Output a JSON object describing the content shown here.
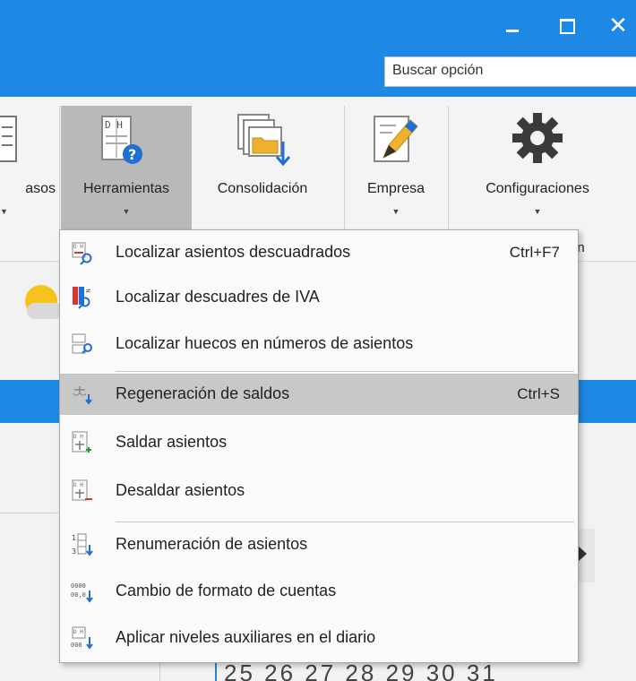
{
  "window": {
    "minimize_label": "minimize",
    "maximize_label": "maximize",
    "close_label": "✕"
  },
  "search": {
    "placeholder": "Buscar opción"
  },
  "ribbon": {
    "buttons": [
      {
        "label": "asos",
        "has_arrow": true
      },
      {
        "label": "Herramientas",
        "has_arrow": true,
        "active": true
      },
      {
        "label": "Consolidación",
        "has_arrow": false
      },
      {
        "label": "Empresa",
        "has_arrow": true
      },
      {
        "label": "Configuraciones",
        "has_arrow": true
      }
    ],
    "group_label_fragment": "ón"
  },
  "menu": {
    "items": [
      {
        "label": "Localizar asientos descuadrados",
        "shortcut": "Ctrl+F7",
        "icon": "locate-unbalanced-icon"
      },
      {
        "label": "Localizar descuadres de IVA",
        "shortcut": "",
        "icon": "locate-vat-icon"
      },
      {
        "label": "Localizar huecos en números de asientos",
        "shortcut": "",
        "icon": "locate-gaps-icon"
      },
      {
        "label": "Regeneración de saldos",
        "shortcut": "Ctrl+S",
        "icon": "regenerate-balances-icon",
        "highlighted": true
      },
      {
        "label": "Saldar asientos",
        "shortcut": "",
        "icon": "settle-entries-icon"
      },
      {
        "label": "Desaldar asientos",
        "shortcut": "",
        "icon": "unsettle-entries-icon"
      },
      {
        "label": "Renumeración de asientos",
        "shortcut": "",
        "icon": "renumber-icon"
      },
      {
        "label": "Cambio de formato de cuentas",
        "shortcut": "",
        "icon": "account-format-icon"
      },
      {
        "label": "Aplicar niveles auxiliares en el diario",
        "shortcut": "",
        "icon": "auxiliary-levels-icon"
      }
    ]
  },
  "calendar": {
    "visible_numbers": "25 26 27 28 29 30 31"
  },
  "colors": {
    "accent": "#1e88e5",
    "highlight": "#c8c8c8"
  }
}
